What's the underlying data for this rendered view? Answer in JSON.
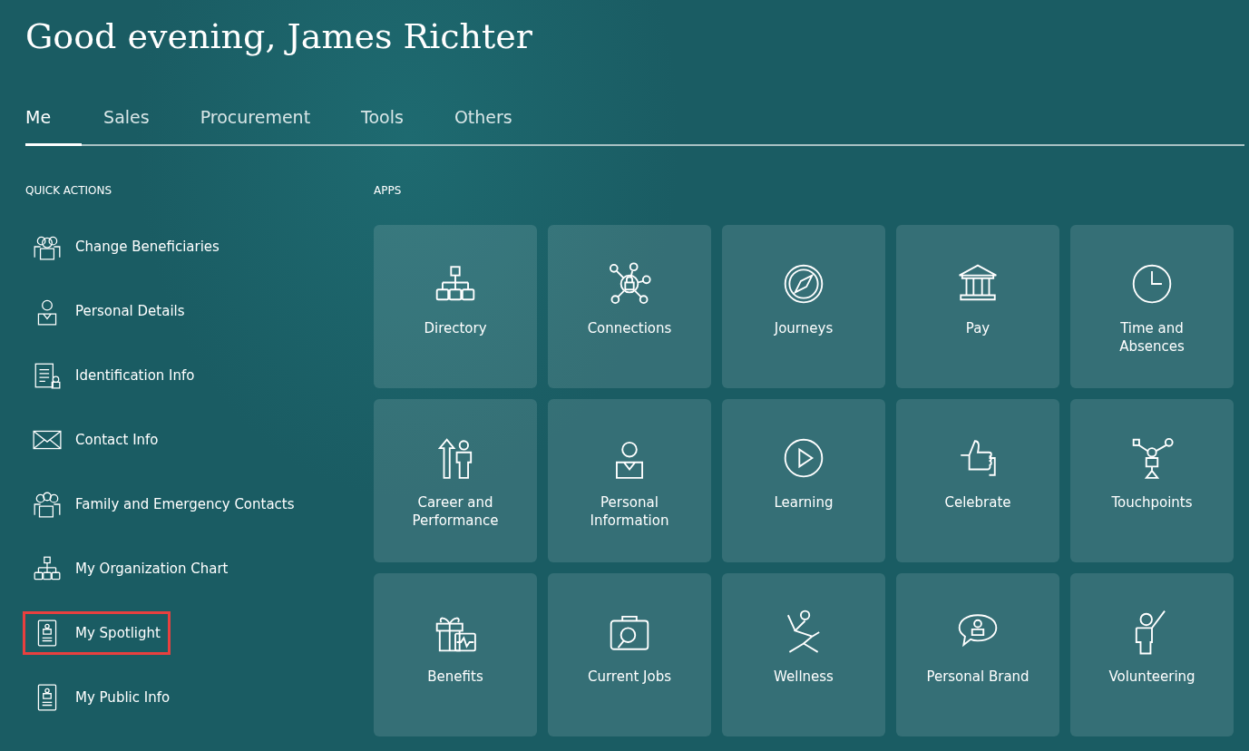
{
  "greeting": "Good evening, James Richter",
  "tabs": [
    {
      "label": "Me",
      "selected": true
    },
    {
      "label": "Sales",
      "selected": false
    },
    {
      "label": "Procurement",
      "selected": false
    },
    {
      "label": "Tools",
      "selected": false
    },
    {
      "label": "Others",
      "selected": false
    }
  ],
  "quick_actions": {
    "heading": "QUICK ACTIONS",
    "items": [
      {
        "label": "Change Beneficiaries",
        "highlighted": false
      },
      {
        "label": "Personal Details",
        "highlighted": false
      },
      {
        "label": "Identification Info",
        "highlighted": false
      },
      {
        "label": "Contact Info",
        "highlighted": false
      },
      {
        "label": "Family and Emergency Contacts",
        "highlighted": false
      },
      {
        "label": "My Organization Chart",
        "highlighted": false
      },
      {
        "label": "My Spotlight",
        "highlighted": true
      },
      {
        "label": "My Public Info",
        "highlighted": false
      }
    ]
  },
  "apps": {
    "heading": "APPS",
    "tiles": [
      {
        "label": "Directory"
      },
      {
        "label": "Connections"
      },
      {
        "label": "Journeys"
      },
      {
        "label": "Pay"
      },
      {
        "label": "Time and Absences"
      },
      {
        "label": "Career and Performance"
      },
      {
        "label": "Personal Information"
      },
      {
        "label": "Learning"
      },
      {
        "label": "Celebrate"
      },
      {
        "label": "Touchpoints"
      },
      {
        "label": "Benefits"
      },
      {
        "label": "Current Jobs"
      },
      {
        "label": "Wellness"
      },
      {
        "label": "Personal Brand"
      },
      {
        "label": "Volunteering"
      }
    ]
  }
}
